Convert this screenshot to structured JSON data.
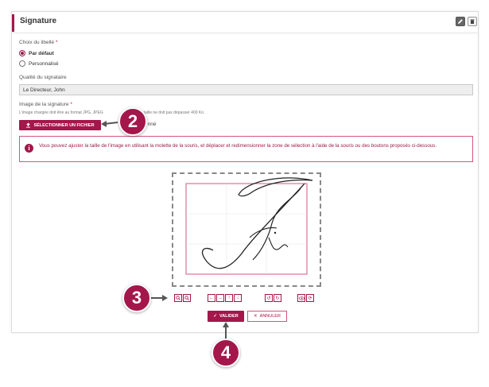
{
  "panel": {
    "title": "Signature",
    "accent": "#a3174a",
    "header_icons": [
      "pencil-icon",
      "trash-icon"
    ]
  },
  "label_choice": {
    "label": "Choix du libellé",
    "required": "*",
    "options": [
      {
        "label": "Par défaut",
        "selected": true
      },
      {
        "label": "Personnalisé",
        "selected": false
      }
    ]
  },
  "signatory": {
    "label": "Qualité du signataire",
    "value": "Le Directeur, John"
  },
  "signature_image": {
    "label": "Image de la signature",
    "required": "*",
    "hint": "L'image chargée doit être au format JPG, JPEG ou PNG et sa taille ne doit pas dépasser 400 Ko.",
    "hint_visible_start": "L'image chargée doit être au format JPG, JPEG",
    "hint_visible_end": "a taille ne doit pas dépasser 400 Ko.",
    "file_button_label": "SÉLECTIONNER UN FICHIER",
    "file_status_start": "A",
    "file_status_end": "nné"
  },
  "alert": {
    "icon": "info-icon",
    "text": "Vous pouvez ajuster la taille de l'image en utilisant la molette de la souris, et déplacer et redimensionner la zone de sélection à l'aide de la souris ou des boutons proposés ci-dessous."
  },
  "toolbar": {
    "zoom": [
      "zoom-in-icon",
      "zoom-out-icon"
    ],
    "move": [
      "arrow-left-icon",
      "arrow-right-icon",
      "arrow-up-icon",
      "arrow-down-icon"
    ],
    "rotate": [
      "rotate-left-icon",
      "rotate-right-icon"
    ],
    "other": [
      "eye-icon",
      "reset-icon"
    ]
  },
  "actions": {
    "validate_label": "VALIDER",
    "cancel_label": "ANNULER"
  },
  "callouts": [
    "2",
    "3",
    "4"
  ]
}
